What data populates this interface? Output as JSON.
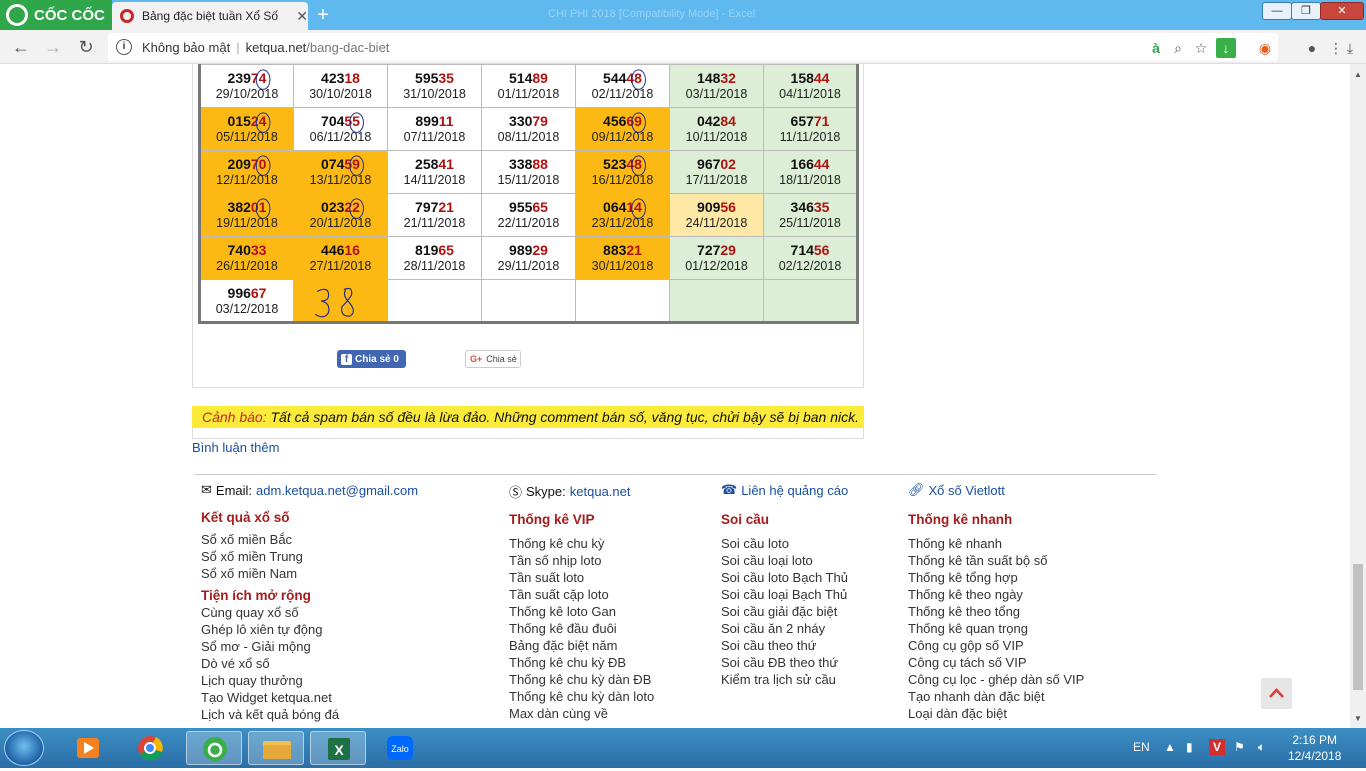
{
  "browser": {
    "brand": "CỐC CỐC",
    "tab_title": "Bảng đặc biệt tuần Xổ Số",
    "tab_close": "✕",
    "new_tab": "+",
    "security_label": "Không bảo mật",
    "url_domain": "ketqua.net",
    "url_path": "/bang-dac-biet",
    "faded_window_title": "CHI PHI 2018 [Compatibility Mode] - Excel"
  },
  "results": {
    "rows": [
      [
        {
          "num_a": "239",
          "num_b": "74",
          "date": "29/10/2018",
          "bg": "w"
        },
        {
          "num_a": "423",
          "num_b": "18",
          "date": "30/10/2018",
          "bg": "w"
        },
        {
          "num_a": "595",
          "num_b": "35",
          "date": "31/10/2018",
          "bg": "w"
        },
        {
          "num_a": "514",
          "num_b": "89",
          "date": "01/11/2018",
          "bg": "w"
        },
        {
          "num_a": "544",
          "num_b": "48",
          "date": "02/11/2018",
          "bg": "w"
        },
        {
          "num_a": "148",
          "num_b": "32",
          "date": "03/11/2018",
          "bg": "g"
        },
        {
          "num_a": "158",
          "num_b": "44",
          "date": "04/11/2018",
          "bg": "g"
        }
      ],
      [
        {
          "num_a": "015",
          "num_b": "24",
          "date": "05/11/2018",
          "bg": "o"
        },
        {
          "num_a": "704",
          "num_b": "55",
          "date": "06/11/2018",
          "bg": "w"
        },
        {
          "num_a": "899",
          "num_b": "11",
          "date": "07/11/2018",
          "bg": "w"
        },
        {
          "num_a": "330",
          "num_b": "79",
          "date": "08/11/2018",
          "bg": "w"
        },
        {
          "num_a": "456",
          "num_b": "69",
          "date": "09/11/2018",
          "bg": "o"
        },
        {
          "num_a": "042",
          "num_b": "84",
          "date": "10/11/2018",
          "bg": "g"
        },
        {
          "num_a": "657",
          "num_b": "71",
          "date": "11/11/2018",
          "bg": "g"
        }
      ],
      [
        {
          "num_a": "209",
          "num_b": "70",
          "date": "12/11/2018",
          "bg": "o"
        },
        {
          "num_a": "074",
          "num_b": "59",
          "date": "13/11/2018",
          "bg": "o"
        },
        {
          "num_a": "258",
          "num_b": "41",
          "date": "14/11/2018",
          "bg": "w"
        },
        {
          "num_a": "338",
          "num_b": "88",
          "date": "15/11/2018",
          "bg": "w"
        },
        {
          "num_a": "523",
          "num_b": "48",
          "date": "16/11/2018",
          "bg": "o"
        },
        {
          "num_a": "967",
          "num_b": "02",
          "date": "17/11/2018",
          "bg": "g"
        },
        {
          "num_a": "166",
          "num_b": "44",
          "date": "18/11/2018",
          "bg": "g"
        }
      ],
      [
        {
          "num_a": "382",
          "num_b": "01",
          "date": "19/11/2018",
          "bg": "o"
        },
        {
          "num_a": "023",
          "num_b": "22",
          "date": "20/11/2018",
          "bg": "o"
        },
        {
          "num_a": "797",
          "num_b": "21",
          "date": "21/11/2018",
          "bg": "w"
        },
        {
          "num_a": "955",
          "num_b": "65",
          "date": "22/11/2018",
          "bg": "w"
        },
        {
          "num_a": "064",
          "num_b": "14",
          "date": "23/11/2018",
          "bg": "o"
        },
        {
          "num_a": "909",
          "num_b": "56",
          "date": "24/11/2018",
          "bg": "y"
        },
        {
          "num_a": "346",
          "num_b": "35",
          "date": "25/11/2018",
          "bg": "g"
        }
      ],
      [
        {
          "num_a": "740",
          "num_b": "33",
          "date": "26/11/2018",
          "bg": "o"
        },
        {
          "num_a": "446",
          "num_b": "16",
          "date": "27/11/2018",
          "bg": "o"
        },
        {
          "num_a": "819",
          "num_b": "65",
          "date": "28/11/2018",
          "bg": "w"
        },
        {
          "num_a": "989",
          "num_b": "29",
          "date": "29/11/2018",
          "bg": "w"
        },
        {
          "num_a": "883",
          "num_b": "21",
          "date": "30/11/2018",
          "bg": "o"
        },
        {
          "num_a": "727",
          "num_b": "29",
          "date": "01/12/2018",
          "bg": "g"
        },
        {
          "num_a": "714",
          "num_b": "56",
          "date": "02/12/2018",
          "bg": "g"
        }
      ],
      [
        {
          "num_a": "996",
          "num_b": "67",
          "date": "03/12/2018",
          "bg": "w"
        },
        {
          "num_a": "",
          "num_b": "",
          "date": "",
          "bg": "o"
        },
        {
          "num_a": "",
          "num_b": "",
          "date": "",
          "bg": "w"
        },
        {
          "num_a": "",
          "num_b": "",
          "date": "",
          "bg": "w"
        },
        {
          "num_a": "",
          "num_b": "",
          "date": "",
          "bg": "w"
        },
        {
          "num_a": "",
          "num_b": "",
          "date": "",
          "bg": "g"
        },
        {
          "num_a": "",
          "num_b": "",
          "date": "",
          "bg": "g"
        }
      ]
    ]
  },
  "share": {
    "facebook": "Chia sẻ 0",
    "google": "Chia sẻ"
  },
  "warning": {
    "label": "Cảnh báo:",
    "text": " Tất cả spam bán số đều là lừa đảo. Những comment bán số, văng tục, chửi bậy sẽ bị ban nick."
  },
  "more_comments": "Bình luận thêm",
  "contacts": {
    "email_label": "Email:",
    "email": "adm.ketqua.net@gmail.com",
    "skype_label": "Skype:",
    "skype": "ketqua.net",
    "ads": "Liên hệ quảng cáo",
    "vietlott": "Xổ số Vietlott"
  },
  "footer": {
    "col1": {
      "head": "Kết quả xổ số",
      "items": [
        "Sổ xố miền Bắc",
        "Sổ xố miền Trung",
        "Sổ xố miền Nam"
      ],
      "head2": "Tiện ích mở rộng",
      "items2": [
        "Cùng quay xổ số",
        "Ghép lô xiên tự động",
        "Sổ mơ - Giải mộng",
        "Dò vé xổ số",
        "Lịch quay thưởng",
        "Tạo Widget ketqua.net",
        "Lịch và kết quả bóng đá"
      ]
    },
    "col2": {
      "head": "Thống kê VIP",
      "items": [
        "Thống kê chu kỳ",
        "Tần số nhịp loto",
        "Tần suất loto",
        "Tần suất cặp loto",
        "Thống kê loto Gan",
        "Thống kê đầu đuôi",
        "Bảng đặc biệt năm",
        "Thống kê chu kỳ ĐB",
        "Thống kê chu kỳ dàn ĐB",
        "Thống kê chu kỳ dàn loto",
        "Max dàn cùng về"
      ]
    },
    "col3": {
      "head": "Soi cầu",
      "items": [
        "Soi cầu loto",
        "Soi cầu loại loto",
        "Soi cầu loto Bạch Thủ",
        "Soi cầu loại Bạch Thủ",
        "Soi cầu giải đặc biệt",
        "Soi cầu ăn 2 nháy",
        "Soi cầu theo thứ",
        "Soi cầu ĐB theo thứ",
        "Kiểm tra lịch sử cầu"
      ]
    },
    "col4": {
      "head": "Thống kê nhanh",
      "items": [
        "Thống kê nhanh",
        "Thống kê tần suất bộ số",
        "Thống kê tổng hợp",
        "Thống kê theo ngày",
        "Thống kê theo tổng",
        "Thống kê quan trọng",
        "Công cụ gộp số VIP",
        "Công cụ tách số VIP",
        "Công cụ lọc - ghép dàn số VIP",
        "Tạo nhanh dàn đặc biệt",
        "Loại dàn đặc biệt"
      ]
    }
  },
  "taskbar": {
    "language": "EN",
    "time": "2:16 PM",
    "date": "12/4/2018"
  },
  "colors": {
    "orange": "#fdb913",
    "green": "#dcefd6",
    "highlight_red": "#b01212",
    "link_blue": "#1a4fa3",
    "warning_yellow": "#fdeb3a"
  }
}
